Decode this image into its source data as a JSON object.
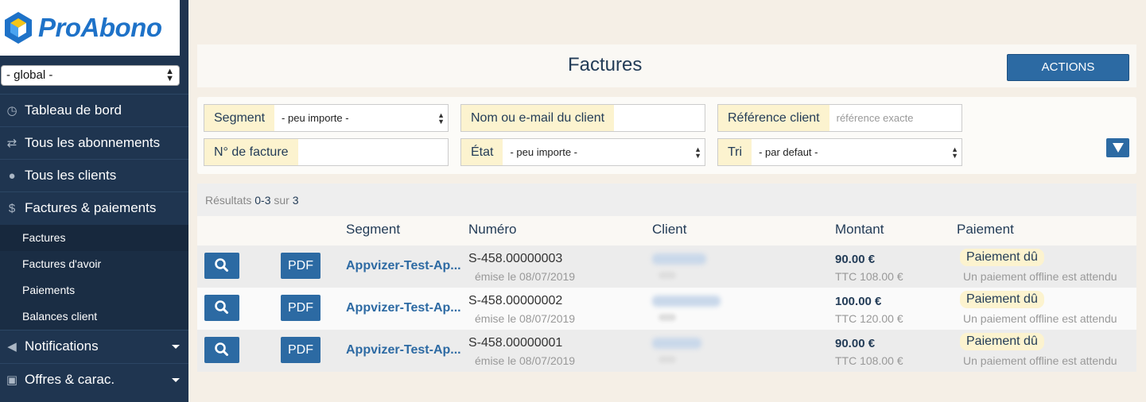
{
  "app": {
    "logo_text": "ProAbono"
  },
  "sidebar": {
    "context_select": "- global -",
    "items": [
      {
        "label": "Tableau de bord",
        "icon": "dashboard-icon"
      },
      {
        "label": "Tous les abonnements",
        "icon": "repeat-icon"
      },
      {
        "label": "Tous les clients",
        "icon": "user-icon"
      },
      {
        "label": "Factures & paiements",
        "icon": "dollar-icon"
      },
      {
        "label": "Notifications",
        "icon": "megaphone-icon"
      },
      {
        "label": "Offres & carac.",
        "icon": "gift-icon"
      }
    ],
    "sub_items": [
      {
        "label": "Factures",
        "active": true
      },
      {
        "label": "Factures d'avoir",
        "active": false
      },
      {
        "label": "Paiements",
        "active": false
      },
      {
        "label": "Balances client",
        "active": false
      }
    ]
  },
  "header": {
    "title": "Factures",
    "actions_label": "ACTIONS"
  },
  "filters": {
    "segment": {
      "label": "Segment",
      "value": "- peu importe -"
    },
    "client": {
      "label": "Nom ou e-mail du client",
      "value": ""
    },
    "reference": {
      "label": "Référence client",
      "placeholder": "référence exacte"
    },
    "invoice_number": {
      "label": "N° de facture",
      "value": ""
    },
    "state": {
      "label": "État",
      "value": "- peu importe -"
    },
    "sort": {
      "label": "Tri",
      "value": "- par defaut -"
    }
  },
  "results": {
    "prefix": "Résultats",
    "range": "0-3",
    "of": "sur",
    "total": "3"
  },
  "table": {
    "columns": {
      "segment": "Segment",
      "number": "Numéro",
      "client": "Client",
      "amount": "Montant",
      "payment": "Paiement"
    },
    "pdf_label": "PDF",
    "rows": [
      {
        "segment": "Appvizer-Test-Ap...",
        "number": "S-458.00000003",
        "date": "émise le 08/07/2019",
        "amount": "90.00 €",
        "ttc": "TTC 108.00 €",
        "status": "Paiement dû",
        "note": "Un paiement offline est attendu"
      },
      {
        "segment": "Appvizer-Test-Ap...",
        "number": "S-458.00000002",
        "date": "émise le 08/07/2019",
        "amount": "100.00 €",
        "ttc": "TTC 120.00 €",
        "status": "Paiement dû",
        "note": "Un paiement offline est attendu"
      },
      {
        "segment": "Appvizer-Test-Ap...",
        "number": "S-458.00000001",
        "date": "émise le 08/07/2019",
        "amount": "90.00 €",
        "ttc": "TTC 108.00 €",
        "status": "Paiement dû",
        "note": "Un paiement offline est attendu"
      }
    ]
  },
  "colors": {
    "sidebar": "#1f3550",
    "accent": "#2c6aa3",
    "highlight": "#fcf3cf",
    "background": "#f5efe6"
  }
}
